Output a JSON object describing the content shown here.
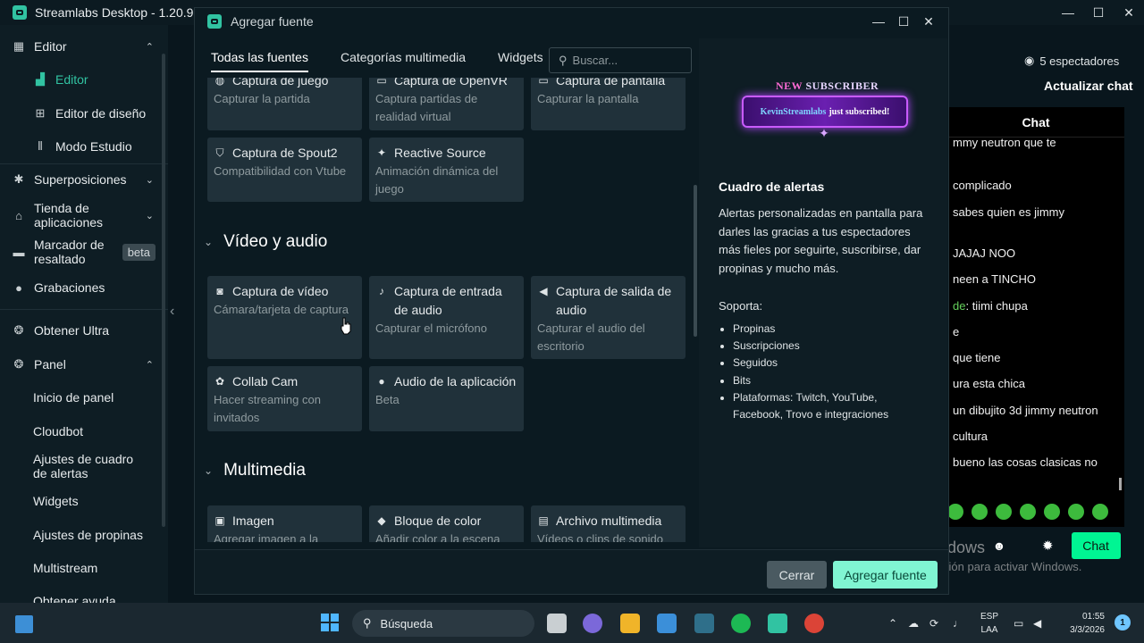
{
  "app": {
    "title": "Streamlabs Desktop - 1.20.9"
  },
  "window_controls": {
    "minimize": "—",
    "maximize": "☐",
    "close": "✕"
  },
  "sidebar": {
    "items": [
      {
        "label": "Editor",
        "icon": "editor-icon",
        "chevron": "up"
      },
      {
        "label": "Editor",
        "icon": "editor-layout-icon",
        "active": true
      },
      {
        "label": "Editor de diseño",
        "icon": "layout-grid-icon"
      },
      {
        "label": "Modo Estudio",
        "icon": "studio-mode-icon"
      },
      {
        "label": "Superposiciones",
        "icon": "overlays-icon",
        "chevron": "down"
      },
      {
        "label": "Tienda de aplicaciones",
        "icon": "app-store-icon",
        "chevron": "down"
      },
      {
        "label": "Marcador de resaltado",
        "icon": "highlighter-icon",
        "badge": "beta"
      },
      {
        "label": "Grabaciones",
        "icon": "recordings-icon"
      },
      {
        "label": "Obtener Ultra",
        "icon": "ultra-icon"
      },
      {
        "label": "Panel",
        "icon": "dashboard-icon",
        "chevron": "up"
      },
      {
        "label": "Inicio de panel"
      },
      {
        "label": "Cloudbot"
      },
      {
        "label": "Ajustes de cuadro de alertas"
      },
      {
        "label": "Widgets"
      },
      {
        "label": "Ajustes de propinas"
      },
      {
        "label": "Multistream"
      },
      {
        "label": "Obtener ayuda"
      }
    ]
  },
  "chat": {
    "viewers": "5 espectadores",
    "refresh": "Actualizar chat",
    "header": "Chat",
    "messages": [
      {
        "text": "mmy neutron que te"
      },
      {
        "text": "complicado"
      },
      {
        "text": "sabes quien es jimmy"
      },
      {
        "text": "JAJAJ NOO"
      },
      {
        "text": "neen a TINCHO"
      },
      {
        "user": "de",
        "text": ": tiimi chupa"
      },
      {
        "text": "e"
      },
      {
        "text": "que tiene"
      },
      {
        "text": "ura esta chica"
      },
      {
        "text": "un dibujito 3d jimmy neutron"
      },
      {
        "text": "cultura"
      },
      {
        "text": "bueno las cosas clasicas no"
      }
    ],
    "send_button": "Chat"
  },
  "watermark": {
    "title": "Activar Windows",
    "subtitle": "Ve a Configuración para activar Windows."
  },
  "modal": {
    "title": "Agregar fuente",
    "tabs": [
      "Todas las fuentes",
      "Categorías multimedia",
      "Widgets"
    ],
    "search_placeholder": "Buscar...",
    "top_cards": [
      {
        "title": "Captura de juego",
        "desc": "Capturar la partida",
        "icon": "gamepad-icon"
      },
      {
        "title": "Captura de OpenVR",
        "desc": "Captura partidas de realidad virtual",
        "icon": "vr-icon"
      },
      {
        "title": "Captura de pantalla",
        "desc": "Capturar la pantalla",
        "icon": "monitor-icon"
      },
      {
        "title": "Captura de Spout2",
        "desc": "Compatibilidad con Vtube",
        "icon": "shield-icon"
      },
      {
        "title": "Reactive Source",
        "desc": "Animación dinámica del juego",
        "icon": "sparkle-icon"
      }
    ],
    "section_video": "Vídeo y audio",
    "video_cards": [
      {
        "title": "Captura de vídeo",
        "desc": "Cámara/tarjeta de captura",
        "icon": "webcam-icon"
      },
      {
        "title": "Captura de entrada de audio",
        "desc": "Capturar el micrófono",
        "icon": "microphone-icon"
      },
      {
        "title": "Captura de salida de audio",
        "desc": "Capturar el audio del escritorio",
        "icon": "speaker-icon"
      },
      {
        "title": "Collab Cam",
        "desc": "Hacer streaming con invitados",
        "icon": "collab-cam-icon"
      },
      {
        "title": "Audio de la aplicación",
        "desc": "Beta",
        "icon": "user-audio-icon"
      }
    ],
    "section_media": "Multimedia",
    "media_cards": [
      {
        "title": "Imagen",
        "desc": "Agregar imagen a la",
        "icon": "image-icon"
      },
      {
        "title": "Bloque de color",
        "desc": "Añadir color a la escena",
        "icon": "paint-bucket-icon"
      },
      {
        "title": "Archivo multimedia",
        "desc": "Vídeos o clips de sonido",
        "icon": "file-icon"
      }
    ],
    "preview": {
      "banner_new": "NEW",
      "banner_subscriber": "SUBSCRIBER",
      "banner_name": "KevinStreamlabs",
      "banner_text": "just subscribed!",
      "title": "Cuadro de alertas",
      "description": "Alertas personalizadas en pantalla para darles las gracias a tus espectadores más fieles por seguirte, suscribirse, dar propinas y mucho más.",
      "supports_label": "Soporta:",
      "supports": [
        "Propinas",
        "Suscripciones",
        "Seguidos",
        "Bits",
        "Plataformas: Twitch, YouTube, Facebook, Trovo e integraciones"
      ]
    },
    "cancel": "Cerrar",
    "add": "Agregar fuente"
  },
  "taskbar": {
    "search_label": "Búsqueda",
    "lang_top": "ESP",
    "lang_bottom": "LAA",
    "time": "01:55",
    "date": "3/3/2026",
    "notifications": "1"
  }
}
